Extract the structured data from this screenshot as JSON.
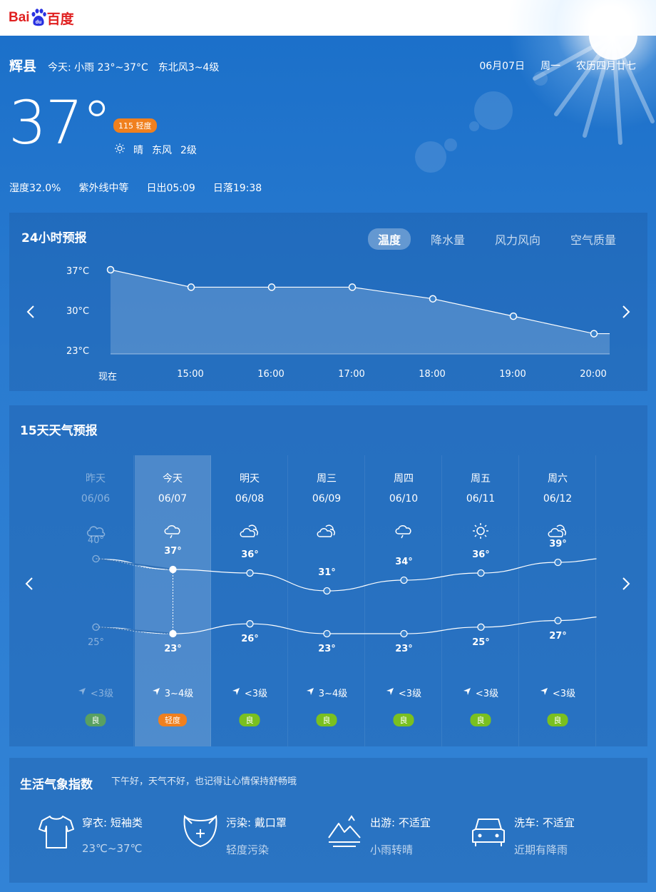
{
  "brand": {
    "logo_left": "Bai",
    "logo_right": "du",
    "logo_cn": "百度"
  },
  "header": {
    "city": "辉县",
    "today_summary": "今天: 小雨 23°~37°C",
    "wind_summary": "东北风3~4级",
    "date": "06月07日",
    "weekday": "周一",
    "lunar": "农历四月廿七"
  },
  "current": {
    "temp": "37°",
    "aqi_badge": "115 轻度",
    "condition": "晴",
    "wind_dir": "东风",
    "wind_level": "2级",
    "humidity": "湿度32.0%",
    "uv": "紫外线中等",
    "sunrise": "日出05:09",
    "sunset": "日落19:38"
  },
  "hourly": {
    "title": "24小时预报",
    "tabs": [
      "温度",
      "降水量",
      "风力风向",
      "空气质量"
    ],
    "active_tab": 0,
    "y_ticks": [
      "37°C",
      "30°C",
      "23°C"
    ],
    "chart_data": {
      "type": "area",
      "x": [
        "现在",
        "15:00",
        "16:00",
        "17:00",
        "18:00",
        "19:00",
        "20:00"
      ],
      "series": [
        {
          "values": [
            37,
            34,
            34,
            34,
            32,
            29,
            26
          ]
        }
      ],
      "ylim": [
        23,
        37
      ],
      "ylabel_ticks": [
        "37°C",
        "30°C",
        "23°C"
      ]
    }
  },
  "daily": {
    "title": "15天天气预报",
    "days": [
      {
        "name": "昨天",
        "date": "06/06",
        "icon": "cloud-icon",
        "high": "40°",
        "low": "25°",
        "wind": "<3级",
        "aq": "良"
      },
      {
        "name": "今天",
        "date": "06/07",
        "icon": "rain-icon",
        "high": "37°",
        "low": "23°",
        "wind": "3~4级",
        "aq": "轻度"
      },
      {
        "name": "明天",
        "date": "06/08",
        "icon": "partly-cloudy-icon",
        "high": "36°",
        "low": "26°",
        "wind": "<3级",
        "aq": "良"
      },
      {
        "name": "周三",
        "date": "06/09",
        "icon": "partly-cloudy-icon",
        "high": "31°",
        "low": "23°",
        "wind": "3~4级",
        "aq": "良"
      },
      {
        "name": "周四",
        "date": "06/10",
        "icon": "rain-icon",
        "high": "34°",
        "low": "23°",
        "wind": "<3级",
        "aq": "良"
      },
      {
        "name": "周五",
        "date": "06/11",
        "icon": "sun-icon",
        "high": "36°",
        "low": "25°",
        "wind": "<3级",
        "aq": "良"
      },
      {
        "name": "周六",
        "date": "06/12",
        "icon": "partly-cloudy-icon",
        "high": "39°",
        "low": "27°",
        "wind": "<3级",
        "aq": "良"
      }
    ],
    "chart_data": {
      "type": "line",
      "x": [
        "06/06",
        "06/07",
        "06/08",
        "06/09",
        "06/10",
        "06/11",
        "06/12"
      ],
      "series": [
        {
          "values": [
            40,
            37,
            36,
            31,
            34,
            36,
            39
          ]
        },
        {
          "values": [
            25,
            23,
            26,
            23,
            23,
            25,
            27
          ]
        }
      ]
    }
  },
  "life": {
    "title": "生活气象指数",
    "greeting": "下午好，天气不好，也记得让心情保持舒畅哦",
    "items": [
      {
        "icon": "tshirt-icon",
        "title": "穿衣: 短袖类",
        "sub": "23℃~37℃"
      },
      {
        "icon": "mask-icon",
        "title": "污染: 戴口罩",
        "sub": "轻度污染"
      },
      {
        "icon": "mountain-icon",
        "title": "出游: 不适宜",
        "sub": "小雨转晴"
      },
      {
        "icon": "car-icon",
        "title": "洗车: 不适宜",
        "sub": "近期有降雨"
      }
    ]
  },
  "colors": {
    "accent_orange": "#f0801e",
    "good_green": "#7ac020",
    "bg_blue": "#2a7bd0"
  }
}
